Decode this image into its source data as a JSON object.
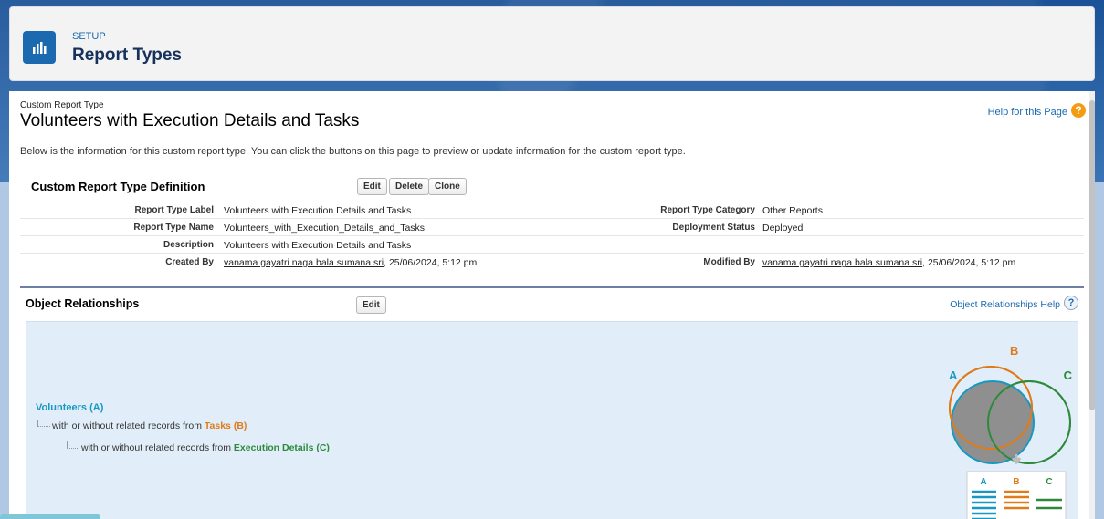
{
  "header": {
    "eyebrow": "SETUP",
    "title": "Report Types",
    "icon": "report-chart-icon",
    "icon_color": "#1b6ab0"
  },
  "page": {
    "eyebrow": "Custom Report Type",
    "title": "Volunteers with Execution Details and Tasks",
    "help_link": "Help for this Page",
    "help_icon_glyph": "?",
    "intro": "Below is the information for this custom report type. You can click the buttons on this page to preview or update information for the custom report type."
  },
  "definition": {
    "section_title": "Custom Report Type Definition",
    "buttons": {
      "edit": "Edit",
      "delete": "Delete",
      "clone": "Clone"
    },
    "rows": [
      {
        "label": "Report Type Label",
        "value": "Volunteers with Execution Details and Tasks",
        "label2": "Report Type Category",
        "value2": "Other Reports"
      },
      {
        "label": "Report Type Name",
        "value": "Volunteers_with_Execution_Details_and_Tasks",
        "label2": "Deployment Status",
        "value2": "Deployed"
      },
      {
        "label": "Description",
        "value": "Volunteers with Execution Details and Tasks",
        "label2": "",
        "value2": ""
      },
      {
        "label": "Created By",
        "value_link": "vanama gayatri naga bala sumana sri",
        "value_suffix": ", 25/06/2024, 5:12 pm",
        "label2": "Modified By",
        "value2_link": "vanama gayatri naga bala sumana sri",
        "value2_suffix": ", 25/06/2024, 5:12 pm"
      }
    ]
  },
  "relationships": {
    "section_title": "Object Relationships",
    "edit_button": "Edit",
    "help_link": "Object Relationships Help",
    "help_icon_glyph": "?",
    "tree": {
      "root": "Volunteers (A)",
      "level1_prefix": "with or without related records from ",
      "level1_object": "Tasks (B)",
      "level2_prefix": "with or without related records from ",
      "level2_object": "Execution Details (C)"
    },
    "venn": {
      "label_a": "A",
      "label_b": "B",
      "label_c": "C",
      "color_a": "#1798c1",
      "color_b": "#e07b19",
      "color_c": "#2e8a3a"
    }
  }
}
